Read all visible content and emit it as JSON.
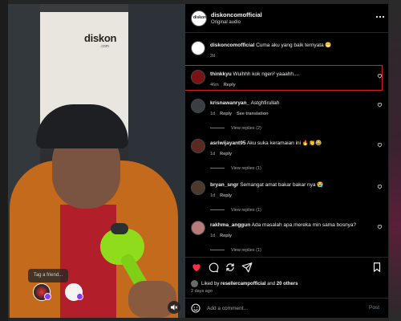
{
  "video": {
    "logo_text": "diskon",
    "logo_sub": ".com",
    "tag_placeholder": "Tag a friend..."
  },
  "header": {
    "username": "diskoncomofficial",
    "audio": "Original audio",
    "more_icon": "more-horizontal-icon"
  },
  "comments": [
    {
      "user": "diskoncomofficial",
      "text": "Cuma aku yang baik ternyata 😁",
      "time": "2d",
      "reply": "",
      "translate": "",
      "view_replies": "",
      "avatar_color": "#ffffff"
    },
    {
      "user": "thinkkyu",
      "text": "Wuihhh kok ngeri² yaaahh....",
      "time": "46m",
      "reply": "Reply",
      "translate": "",
      "view_replies": "",
      "avatar_color": "#7a1414"
    },
    {
      "user": "krisnawanryan_",
      "text": "Astghfirullah",
      "time": "1d",
      "reply": "Reply",
      "translate": "See translation",
      "view_replies": "View replies (2)",
      "avatar_color": "#3a3f44"
    },
    {
      "user": "asriwijayant95",
      "text": "Aku suka keramaian ini 🔥👏😂",
      "time": "1d",
      "reply": "Reply",
      "translate": "",
      "view_replies": "View replies (1)",
      "avatar_color": "#5a2a22"
    },
    {
      "user": "bryan_sngr",
      "text": "Semangat amat bakar bakar nya 😭",
      "time": "1d",
      "reply": "Reply",
      "translate": "",
      "view_replies": "View replies (1)",
      "avatar_color": "#4a3a2e"
    },
    {
      "user": "rakhma_anggun",
      "text": "Ada masalah apa mereka min sama bosnya?",
      "time": "1d",
      "reply": "Reply",
      "translate": "",
      "view_replies": "View replies (1)",
      "avatar_color": "#b97a7a"
    }
  ],
  "actions": {
    "liked_prefix": "Liked by",
    "liked_user": "resellercampofficial",
    "liked_and": "and",
    "liked_others": "20 others",
    "time_ago": "2 days ago",
    "heart_color": "#ff3040"
  },
  "add_comment": {
    "placeholder": "Add a comment...",
    "post_label": "Post"
  }
}
